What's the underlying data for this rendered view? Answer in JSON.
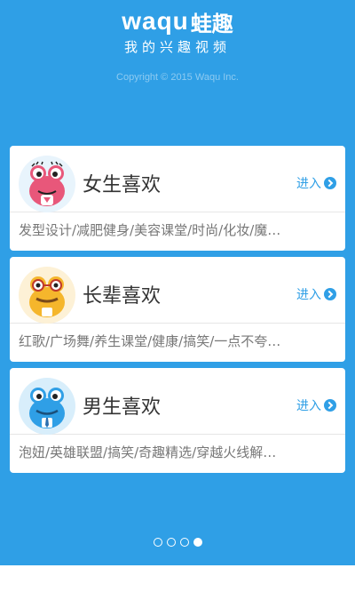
{
  "header": {
    "logo_latin": "waqu",
    "logo_cn": "蛙趣",
    "tagline": "我的兴趣视频",
    "copyright": "Copyright © 2015 Waqu Inc."
  },
  "cards": [
    {
      "title": "女生喜欢",
      "enter_label": "进入",
      "tags": "发型设计/减肥健身/美容课堂/时尚/化妆/魔…",
      "avatar_icon": "pink-frog-avatar-icon",
      "avatar_color": "#e8577a"
    },
    {
      "title": "长辈喜欢",
      "enter_label": "进入",
      "tags": "红歌/广场舞/养生课堂/健康/搞笑/一点不夸…",
      "avatar_icon": "yellow-frog-avatar-icon",
      "avatar_color": "#f5b62c"
    },
    {
      "title": "男生喜欢",
      "enter_label": "进入",
      "tags": "泡妞/英雄联盟/搞笑/奇趣精选/穿越火线解…",
      "avatar_icon": "blue-frog-avatar-icon",
      "avatar_color": "#2f9fe6"
    }
  ],
  "pager": {
    "total": 4,
    "active_index": 3
  },
  "colors": {
    "background": "#2f9fe6",
    "accent": "#2f9fe6",
    "card": "#ffffff"
  }
}
